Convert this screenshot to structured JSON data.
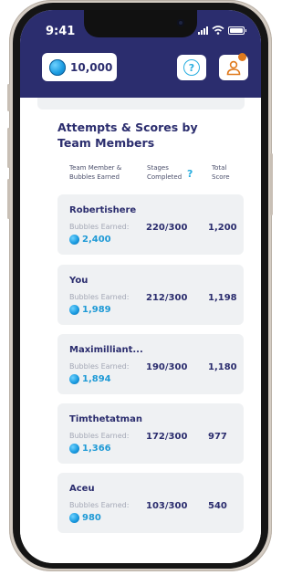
{
  "status_bar": {
    "time": "9:41"
  },
  "header": {
    "bubbles_count": "10,000",
    "help_symbol": "?"
  },
  "section": {
    "title": "Attempts & Scores by Team Members",
    "col_member": "Team Member & Bubbles Earned",
    "col_stages": "Stages Completed",
    "col_help": "?",
    "col_total": "Total Score"
  },
  "members": [
    {
      "name": "Robertishere",
      "bubbles_label": "Bubbles Earned:",
      "bubbles": "2,400",
      "stages": "220/300",
      "score": "1,200"
    },
    {
      "name": "You",
      "bubbles_label": "Bubbles Earned:",
      "bubbles": "1,989",
      "stages": "212/300",
      "score": "1,198"
    },
    {
      "name": "Maximilliant...",
      "bubbles_label": "Bubbles Earned:",
      "bubbles": "1,894",
      "stages": "190/300",
      "score": "1,180"
    },
    {
      "name": "Timthetatman",
      "bubbles_label": "Bubbles Earned:",
      "bubbles": "1,366",
      "stages": "172/300",
      "score": "977"
    },
    {
      "name": "Aceu",
      "bubbles_label": "Bubbles Earned:",
      "bubbles": "980",
      "stages": "103/300",
      "score": "540"
    }
  ],
  "colors": {
    "brand_navy": "#2b2d6e",
    "accent_blue": "#29aee0",
    "notification_orange": "#e07a1d",
    "card_bg": "#eff1f3"
  }
}
